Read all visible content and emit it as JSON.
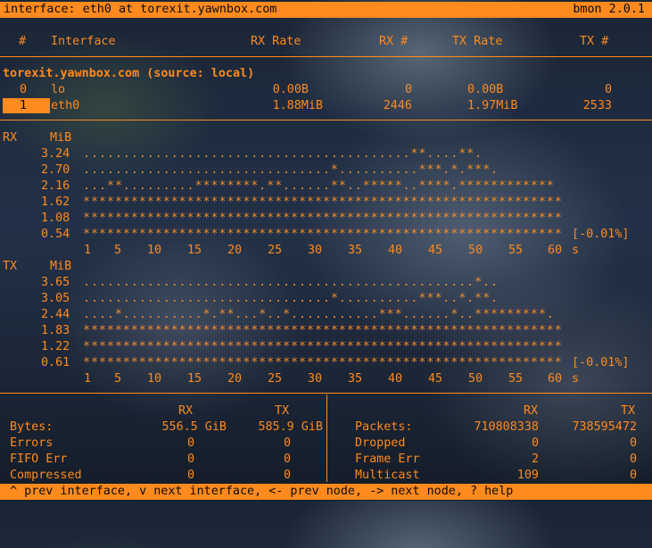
{
  "title_bar": {
    "left": "interface: eth0 at torexit.yawnbox.com",
    "right": "bmon 2.0.1"
  },
  "table_header": {
    "num": "#",
    "interface": "Interface",
    "rx_rate": "RX Rate",
    "rx_num": "RX #",
    "tx_rate": "TX Rate",
    "tx_num": "TX #"
  },
  "host": "torexit.yawnbox.com (source: local)",
  "interfaces": [
    {
      "num": "0",
      "name": "lo",
      "rx_rate": "0.00B",
      "rx_num": "0",
      "tx_rate": "0.00B",
      "tx_num": "0"
    },
    {
      "num": "1",
      "name": "eth0",
      "rx_rate": "1.88MiB",
      "rx_num": "2446",
      "tx_rate": "1.97MiB",
      "tx_num": "2533"
    }
  ],
  "rx_graph": {
    "label": "RX",
    "unit": "MiB",
    "rows": [
      {
        "value": "3.24",
        "bars": ".........................................**....**."
      },
      {
        "value": "2.70",
        "bars": "...............................*..........***.*.***."
      },
      {
        "value": "2.16",
        "bars": "...**.........********.**......**..*****..****.************"
      },
      {
        "value": "1.62",
        "bars": "************************************************************"
      },
      {
        "value": "1.08",
        "bars": "************************************************************"
      },
      {
        "value": "0.54",
        "bars": "************************************************************",
        "suffix": "[-0.01%]"
      }
    ],
    "ticks": [
      "1",
      "5",
      "10",
      "15",
      "20",
      "25",
      "30",
      "35",
      "40",
      "45",
      "50",
      "55",
      "60"
    ],
    "tick_unit": "s"
  },
  "tx_graph": {
    "label": "TX",
    "unit": "MiB",
    "rows": [
      {
        "value": "3.65",
        "bars": ".................................................*.."
      },
      {
        "value": "3.05",
        "bars": "...............................*..........***..*.**."
      },
      {
        "value": "2.44",
        "bars": "....*..........*.**...*..*...........***......*..*********."
      },
      {
        "value": "1.83",
        "bars": "************************************************************"
      },
      {
        "value": "1.22",
        "bars": "************************************************************"
      },
      {
        "value": "0.61",
        "bars": "************************************************************",
        "suffix": "[-0.01%]"
      }
    ],
    "ticks": [
      "1",
      "5",
      "10",
      "15",
      "20",
      "25",
      "30",
      "35",
      "40",
      "45",
      "50",
      "55",
      "60"
    ],
    "tick_unit": "s"
  },
  "stats_left": {
    "col_rx": "RX",
    "col_tx": "TX",
    "rows": [
      {
        "label": "Bytes:",
        "rx": "556.5 GiB",
        "tx": "585.9 GiB"
      },
      {
        "label": "Errors",
        "rx": "0",
        "tx": "0"
      },
      {
        "label": "FIFO Err",
        "rx": "0",
        "tx": "0"
      },
      {
        "label": "Compressed",
        "rx": "0",
        "tx": "0"
      }
    ]
  },
  "stats_right": {
    "col_rx": "RX",
    "col_tx": "TX",
    "rows": [
      {
        "label": "Packets:",
        "rx": "710808338",
        "tx": "738595472"
      },
      {
        "label": "Dropped",
        "rx": "0",
        "tx": "0"
      },
      {
        "label": "Frame Err",
        "rx": "2",
        "tx": "0"
      },
      {
        "label": "Multicast",
        "rx": "109",
        "tx": "0"
      }
    ]
  },
  "footer": "^ prev interface, v next interface, <- prev node, -> next node, ? help"
}
